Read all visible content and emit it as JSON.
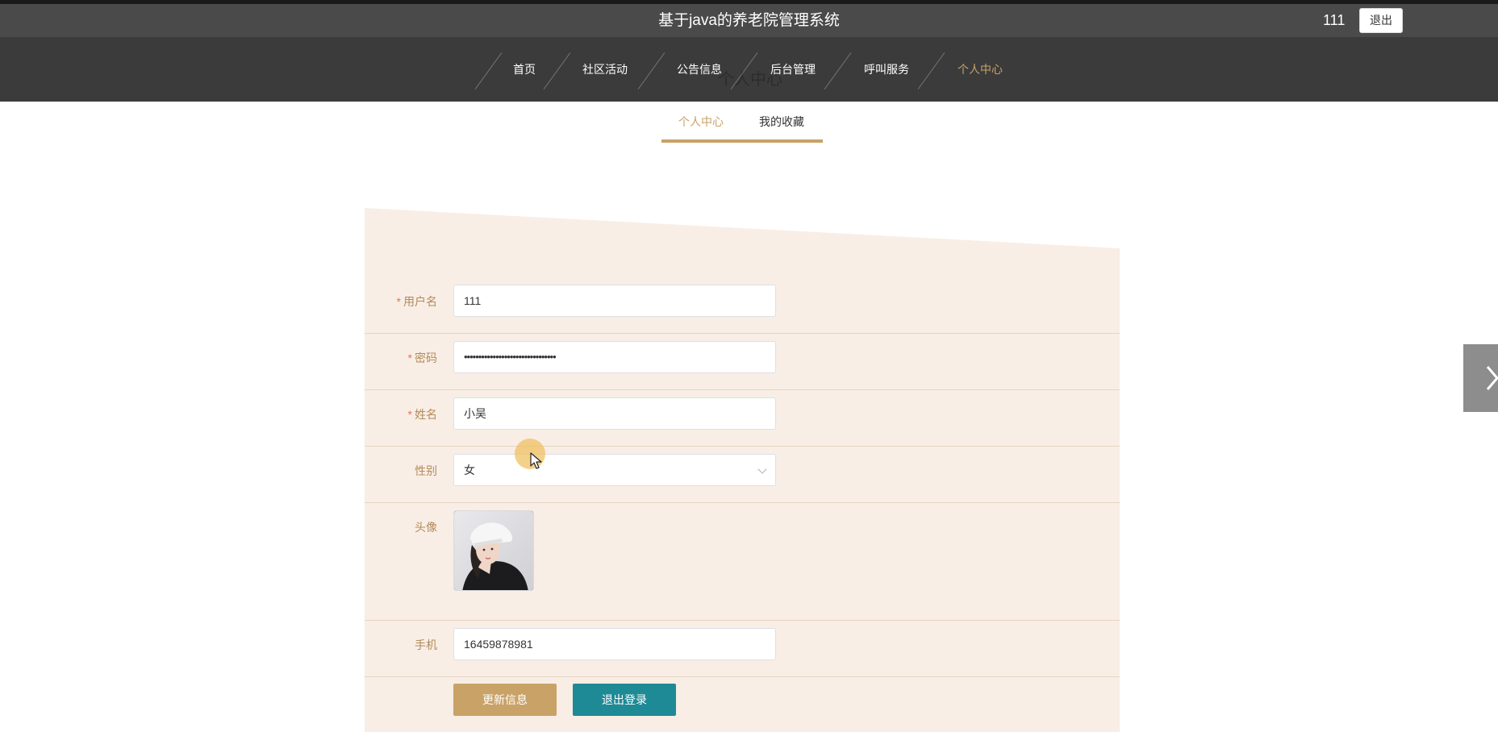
{
  "header": {
    "app_title": "基于java的养老院管理系统",
    "username": "111",
    "logout_label": "退出"
  },
  "nav": {
    "items": [
      {
        "label": "首页"
      },
      {
        "label": "社区活动"
      },
      {
        "label": "公告信息"
      },
      {
        "label": "后台管理"
      },
      {
        "label": "呼叫服务"
      },
      {
        "label": "个人中心"
      }
    ],
    "active": "个人中心",
    "page_title_ghost": "个人中心"
  },
  "subtabs": {
    "items": [
      {
        "label": "个人中心"
      },
      {
        "label": "我的收藏"
      }
    ],
    "active": "个人中心"
  },
  "form": {
    "username": {
      "label": "用户名",
      "required": "*",
      "value": "111"
    },
    "password": {
      "label": "密码",
      "required": "*",
      "value": "••••••••••••••••••••••••••••••••"
    },
    "name": {
      "label": "姓名",
      "required": "*",
      "value": "小吴"
    },
    "gender": {
      "label": "性别",
      "value": "女"
    },
    "avatar": {
      "label": "头像"
    },
    "phone": {
      "label": "手机",
      "value": "16459878981"
    },
    "update_label": "更新信息",
    "logout_label": "退出登录"
  },
  "colors": {
    "accent": "#c8a267",
    "logout_button": "#1e8a95",
    "panel_bg": "#f8eee5"
  },
  "icons": {
    "select_arrow": "chevron-down-icon",
    "side_nav": "chevron-right-icon",
    "pointer": "cursor-icon"
  }
}
